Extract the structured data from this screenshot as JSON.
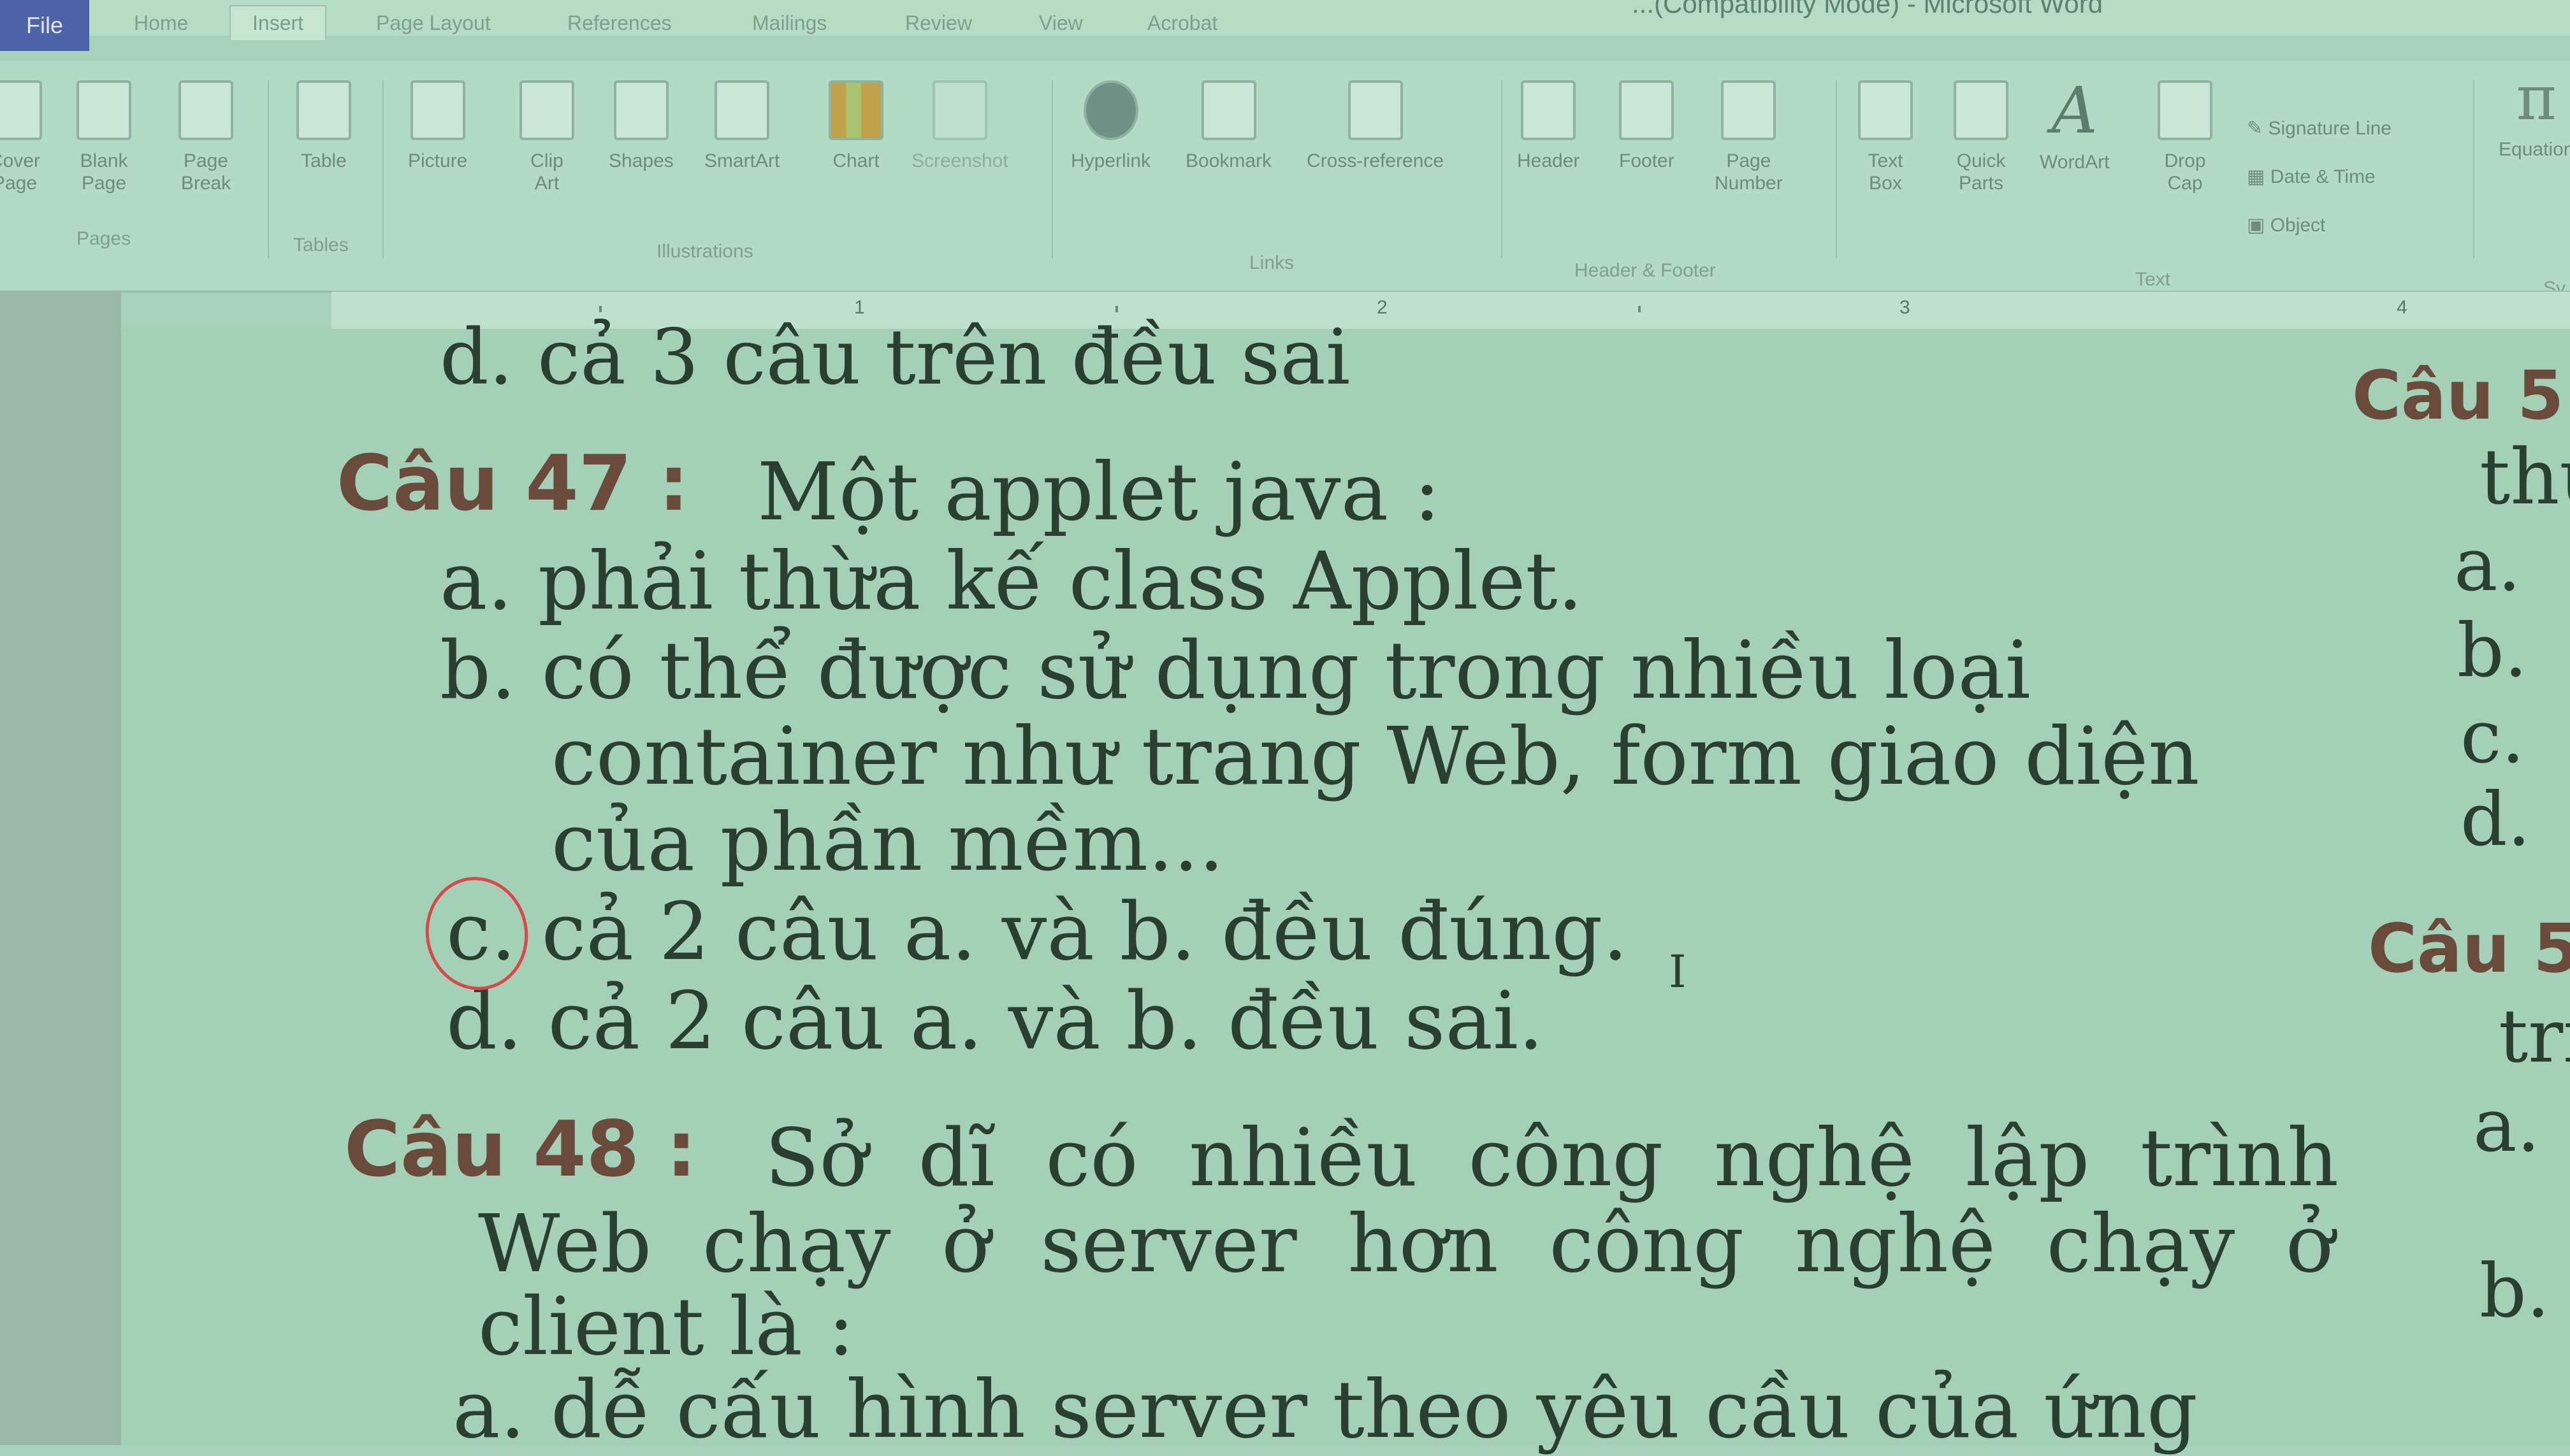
{
  "window": {
    "title": "...(Compatibility Mode) - Microsoft Word",
    "file_tab": "File"
  },
  "tabs": [
    "Home",
    "Insert",
    "Page Layout",
    "References",
    "Mailings",
    "Review",
    "View",
    "Acrobat"
  ],
  "ribbon": {
    "pages": {
      "cover": "Cover\nPage",
      "blank": "Blank\nPage",
      "break": "Page\nBreak",
      "group": "Pages"
    },
    "tables": {
      "table": "Table",
      "group": "Tables"
    },
    "illustrations": {
      "picture": "Picture",
      "clipart": "Clip\nArt",
      "shapes": "Shapes",
      "smartart": "SmartArt",
      "chart": "Chart",
      "screenshot": "Screenshot",
      "group": "Illustrations"
    },
    "links": {
      "hyperlink": "Hyperlink",
      "bookmark": "Bookmark",
      "crossref": "Cross-reference",
      "group": "Links"
    },
    "header_footer": {
      "header": "Header",
      "footer": "Footer",
      "page_number": "Page\nNumber",
      "group": "Header & Footer"
    },
    "text": {
      "textbox": "Text\nBox",
      "quickparts": "Quick\nParts",
      "wordart": "WordArt",
      "dropcap": "Drop\nCap",
      "signature": "Signature Line",
      "datetime": "Date & Time",
      "object": "Object",
      "group": "Text"
    },
    "symbols": {
      "equation": "Equation",
      "group": "Sy"
    }
  },
  "ruler": {
    "numbers": [
      "1",
      "2",
      "3",
      "4"
    ]
  },
  "document": {
    "prev_answer_d": "d.  cả 3 câu trên đều sai",
    "q47": {
      "label": "Câu 47 :",
      "question": "Một applet java :",
      "options": {
        "a": "a.  phải thừa kế class Applet.",
        "b1": "b.  có thể được sử dụng trong nhiều loại",
        "b2": "container như trang Web, form giao diện",
        "b3": "của phần mềm...",
        "c": "c.  cả 2 câu a. và b. đều đúng.",
        "d": "d.  cả 2 câu a. và b. đều sai."
      }
    },
    "q48": {
      "label": "Câu 48 :",
      "line1": "Sở dĩ có nhiều công nghệ lập trình",
      "line2": "Web chạy ở server hơn công nghệ chạy ở",
      "line3": "client là :",
      "option_a": "a.  dễ cấu hình server theo yêu cầu của ứng"
    },
    "right_column": {
      "q5x_a": "Câu 5",
      "thu": "thu",
      "a": "a.",
      "b": "b.",
      "c": "c.",
      "d": "d.",
      "q5x_b": "Câu 5",
      "tri": "tri",
      "a2": "a.",
      "b2": "b."
    }
  }
}
